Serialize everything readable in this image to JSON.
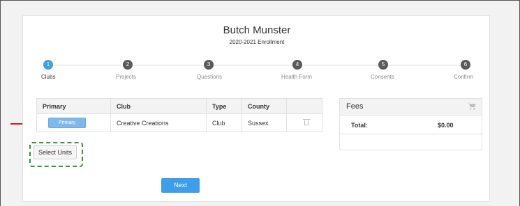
{
  "header": {
    "title": "Butch Munster",
    "subtitle": "2020-2021 Enrollment"
  },
  "steps": [
    {
      "num": "1",
      "label": "Clubs",
      "active": true
    },
    {
      "num": "2",
      "label": "Projects"
    },
    {
      "num": "3",
      "label": "Questions"
    },
    {
      "num": "4",
      "label": "Health Form"
    },
    {
      "num": "5",
      "label": "Consents"
    },
    {
      "num": "6",
      "label": "Confirm"
    }
  ],
  "clubs_table": {
    "headers": [
      "Primary",
      "Club",
      "Type",
      "County",
      ""
    ],
    "rows": [
      {
        "primary_label": "Primary",
        "club": "Creative Creations",
        "type": "Club",
        "county": "Sussex"
      }
    ]
  },
  "fees": {
    "title": "Fees",
    "total_label": "Total:",
    "total_value": "$0.00"
  },
  "actions": {
    "select_units_label": "Select Units",
    "next_label": "Next"
  },
  "colors": {
    "accent": "#3e9ee8",
    "annotation_arrow": "#cc1f1f",
    "annotation_box": "#2e9a2e"
  },
  "icons": {
    "delete": "trash-icon",
    "fees": "cart-icon"
  }
}
